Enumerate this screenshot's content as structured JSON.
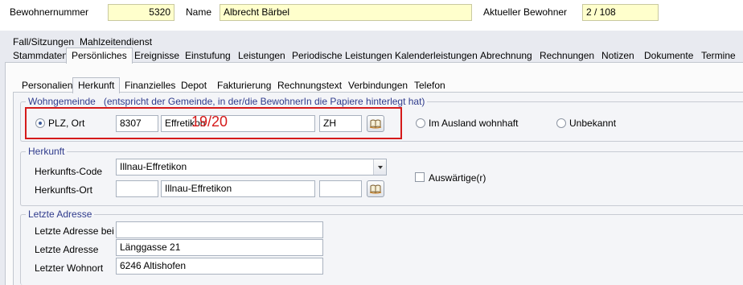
{
  "header": {
    "resident_number_label": "Bewohnernummer",
    "resident_number_value": "5320",
    "name_label": "Name",
    "name_value": "Albrecht Bärbel",
    "current_resident_label": "Aktueller Bewohner",
    "current_resident_value": "2 / 108"
  },
  "main_tabs_row1": [
    "Fall/Sitzungen",
    "Mahlzeitendienst"
  ],
  "main_tabs_row2": [
    "Stammdaten",
    "Persönliches",
    "Ereignisse",
    "Einstufung",
    "Leistungen",
    "Periodische Leistungen",
    "Kalenderleistungen",
    "Abrechnung",
    "Rechnungen",
    "Notizen",
    "Dokumente",
    "Termine"
  ],
  "main_tabs_selected": "Persönliches",
  "sub_tabs": [
    "Personalien",
    "Herkunft",
    "Finanzielles",
    "Depot",
    "Fakturierung",
    "Rechnungstext",
    "Verbindungen",
    "Telefon"
  ],
  "sub_tabs_selected": "Herkunft",
  "wohngemeinde": {
    "title": "Wohngemeinde",
    "note": "(entspricht der Gemeinde, in der/die BewohnerIn die Papiere hinterlegt hat)",
    "radio_plz_label": "PLZ, Ort",
    "radio_plz_selected": true,
    "plz_value": "8307",
    "ort_value": "Effretikon",
    "canton_value": "ZH",
    "radio_abroad_label": "Im Ausland wohnhaft",
    "radio_unknown_label": "Unbekannt",
    "annotation": "19/20"
  },
  "herkunft": {
    "title": "Herkunft",
    "code_label": "Herkunfts-Code",
    "code_value": "Illnau-Effretikon",
    "ort_label": "Herkunfts-Ort",
    "plz_value": "",
    "ort_value": "Illnau-Effretikon",
    "canton_value": "",
    "foreign_label": "Auswärtige(r)",
    "foreign_checked": false
  },
  "letzte_adresse": {
    "title": "Letzte Adresse",
    "bei_label": "Letzte Adresse bei",
    "bei_value": "",
    "adresse_label": "Letzte Adresse",
    "adresse_value": "Länggasse 21",
    "wohnort_label": "Letzter Wohnort",
    "wohnort_value": "6246 Altishofen"
  },
  "colors": {
    "highlight_red": "#d51a1a",
    "yellow_field": "#ffffcc",
    "group_title": "#2f3b8c"
  }
}
